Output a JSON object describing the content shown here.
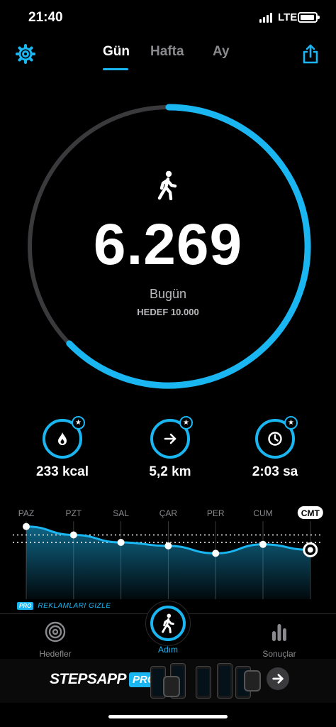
{
  "status_bar": {
    "time": "21:40",
    "network": "LTE"
  },
  "header": {
    "settings_icon": "gear-icon",
    "share_icon": "share-icon",
    "tabs": [
      {
        "label": "Gün",
        "active": true
      },
      {
        "label": "Hafta",
        "active": false
      },
      {
        "label": "Ay",
        "active": false
      }
    ]
  },
  "today": {
    "icon": "walking-person-icon",
    "steps": "6.269",
    "label": "Bugün",
    "goal_label": "HEDEF 10.000",
    "progress_fraction": 0.6269
  },
  "stats": [
    {
      "icon": "flame-icon",
      "value": "233 kcal"
    },
    {
      "icon": "arrow-right-icon",
      "value": "5,2 km"
    },
    {
      "icon": "clock-icon",
      "value": "2:03 sa"
    }
  ],
  "week": {
    "days": [
      "PAZ",
      "PZT",
      "SAL",
      "ÇAR",
      "PER",
      "CUM",
      "CMT"
    ],
    "selected_index": 6,
    "relative_levels": [
      0.92,
      0.75,
      0.6,
      0.53,
      0.38,
      0.56,
      0.45
    ],
    "goal_level": 0.75,
    "average_level": 0.6
  },
  "remove_ads": {
    "badge": "PRO",
    "label": "REKLAMLARI GIZLE"
  },
  "tab_bar": {
    "items": [
      {
        "label": "Hedefler",
        "icon": "target-icon"
      },
      {
        "label": "Adım",
        "icon": "walking-person-icon",
        "active": true
      },
      {
        "label": "Sonuçlar",
        "icon": "bar-chart-icon"
      }
    ]
  },
  "banner": {
    "brand": "STEPSAPP",
    "pro": "PRO",
    "icon": "arrow-right-icon"
  },
  "colors": {
    "accent": "#1ab6f2",
    "background": "#000000",
    "track": "#3a3a3c"
  }
}
